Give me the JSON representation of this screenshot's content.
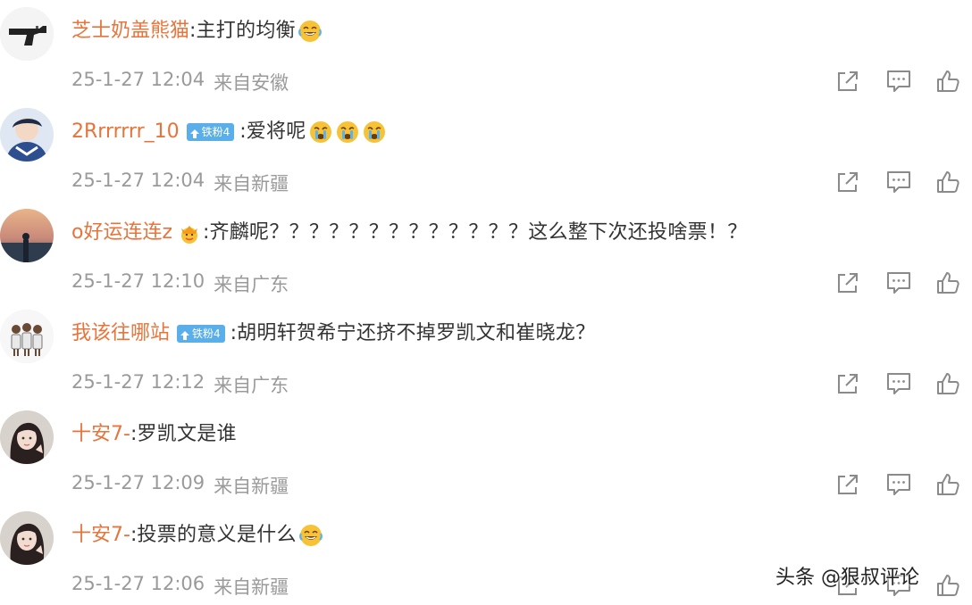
{
  "comments": [
    {
      "username": "芝士奶盖熊猫",
      "badge": "",
      "colon": ":",
      "text": "主打的均衡",
      "stickers": [
        "laugh-cry-emoji"
      ],
      "crown": "",
      "time": "25-1-27 12:04",
      "location": "来自安徽",
      "avatar": "avatar-gun"
    },
    {
      "username": "2Rrrrrrr_10",
      "badge": "铁粉4",
      "colon": ":",
      "text": "爱将呢",
      "stickers": [
        "crying-emoji",
        "crying-emoji",
        "crying-emoji"
      ],
      "crown": "",
      "time": "25-1-27 12:04",
      "location": "来自新疆",
      "avatar": "avatar-cartoon"
    },
    {
      "username": "o好运连连z",
      "badge": "",
      "colon": ":",
      "text": "齐麟呢？？？？？？？？？？？？？这么整下次还投啥票！？",
      "stickers": [],
      "crown": "crown-emoji",
      "time": "25-1-27 12:10",
      "location": "来自广东",
      "avatar": "avatar-sunset"
    },
    {
      "username": "我该往哪站",
      "badge": "铁粉4",
      "colon": ":",
      "text": "胡明轩贺希宁还挤不掉罗凯文和崔晓龙？",
      "stickers": [],
      "crown": "",
      "time": "25-1-27 12:12",
      "location": "来自广东",
      "avatar": "avatar-players"
    },
    {
      "username": "十安7-",
      "badge": "",
      "colon": ":",
      "text": "罗凯文是谁",
      "stickers": [],
      "crown": "",
      "time": "25-1-27 12:09",
      "location": "来自新疆",
      "avatar": "avatar-girl"
    },
    {
      "username": "十安7-",
      "badge": "",
      "colon": ":",
      "text": "投票的意义是什么",
      "stickers": [
        "laugh-cry-emoji"
      ],
      "crown": "",
      "time": "25-1-27 12:06",
      "location": "来自新疆",
      "avatar": "avatar-girl"
    }
  ],
  "watermark": "头条 @狠叔评论",
  "colors": {
    "username": "#e8743b",
    "meta": "#9a9a9a",
    "badge": "#5aaeea",
    "icon": "#8a8a8a"
  }
}
